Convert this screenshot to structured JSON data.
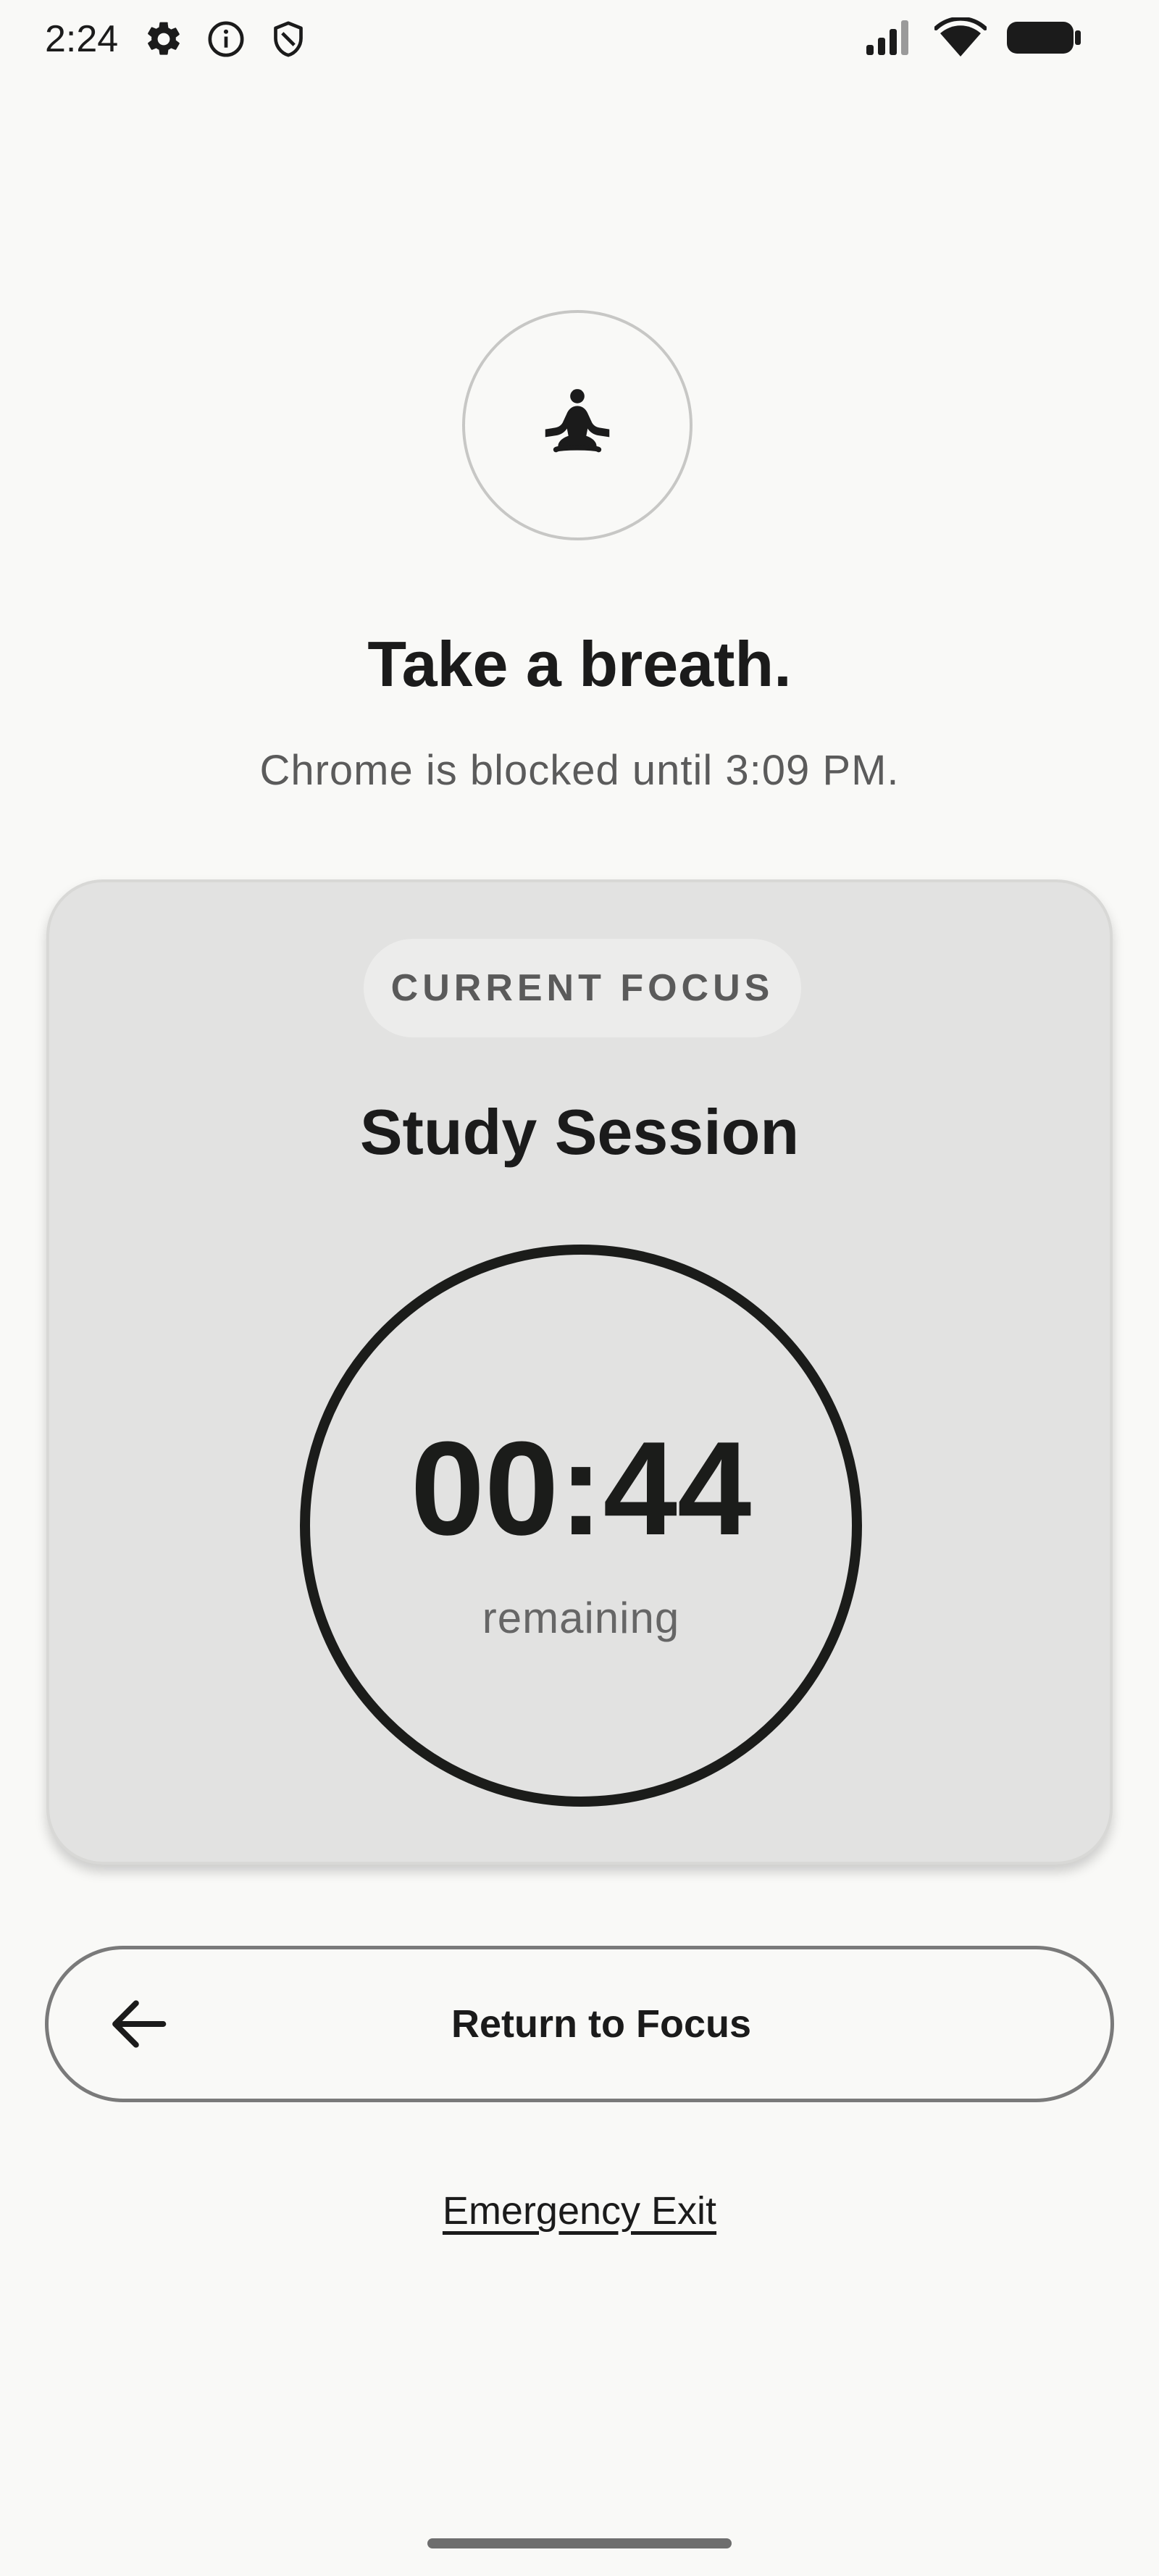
{
  "status_bar": {
    "time": "2:24",
    "left_icons": [
      "settings-icon",
      "info-icon",
      "shield-icon"
    ],
    "right_icons": [
      "cellular-signal-icon",
      "wifi-icon",
      "battery-icon"
    ]
  },
  "hero": {
    "icon": "meditation-icon",
    "title": "Take a breath.",
    "subtitle": "Chrome is blocked until 3:09 PM."
  },
  "focus_card": {
    "chip_label": "CURRENT FOCUS",
    "session_name": "Study Session",
    "timer": {
      "value": "00:44",
      "label": "remaining"
    }
  },
  "actions": {
    "return_label": "Return to Focus",
    "return_icon": "arrow-back-icon",
    "emergency_label": "Emergency Exit"
  },
  "colors": {
    "background": "#f9f9f7",
    "card": "#e2e2e1",
    "text_primary": "#1b1b1b",
    "text_secondary": "#5b5b5b"
  }
}
